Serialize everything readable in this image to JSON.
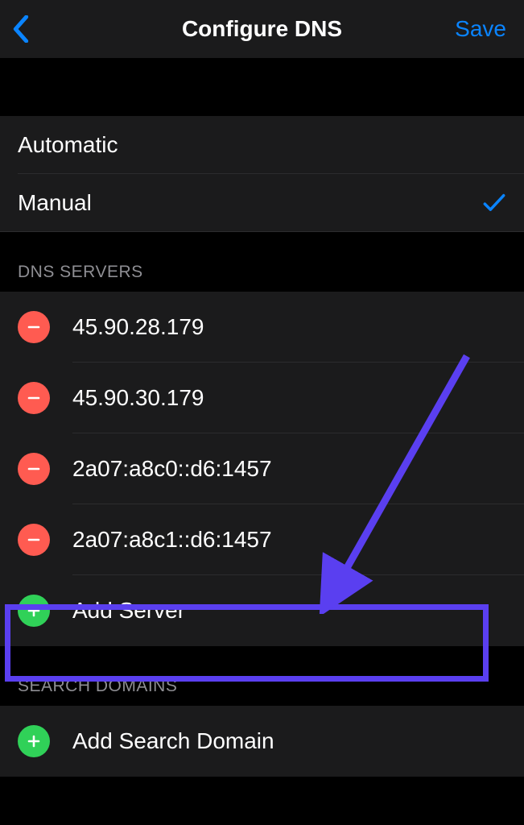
{
  "nav": {
    "title": "Configure DNS",
    "save_label": "Save"
  },
  "mode": {
    "automatic_label": "Automatic",
    "manual_label": "Manual"
  },
  "sections": {
    "dns_servers_header": "DNS SERVERS",
    "search_domains_header": "SEARCH DOMAINS"
  },
  "dns_servers": [
    "45.90.28.179",
    "45.90.30.179",
    "2a07:a8c0::d6:1457",
    "2a07:a8c1::d6:1457"
  ],
  "add_server_label": "Add Server",
  "add_search_domain_label": "Add Search Domain",
  "colors": {
    "accent_blue": "#0a84ff",
    "delete_red": "#ff5b51",
    "add_green": "#30d158",
    "annotation_purple": "#5a3ff0"
  }
}
